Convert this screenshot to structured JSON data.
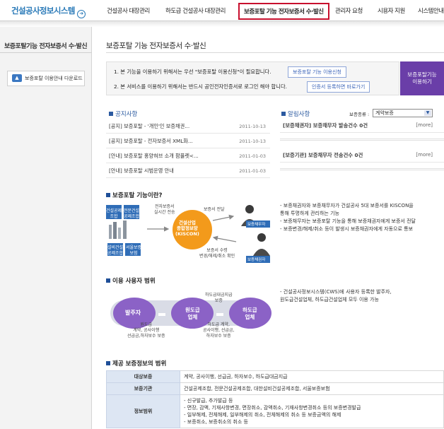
{
  "header": {
    "logo": "건설공사정보시스템",
    "nav": [
      "건설공사 대장관리",
      "하도급 건설공사 대장관리",
      "보증포탈 기능 전자보증서 수·발신",
      "관리자 요청",
      "시용자 지원",
      "시스템안내"
    ]
  },
  "sidebar": {
    "title": "보증포탈기능 전자보증서 수·발신",
    "download_label": "보증포탈 이용안내 다운로드"
  },
  "page_title": "보증포탈 기능 전자보증서 수·발신",
  "notice": {
    "line1": "1. 본 기능을 이용하기 위해서는 우선 \"보증포탈 이용신청\"이 필요합니다.",
    "btn1": "보증포탈 기능 이용신청",
    "line2": "2. 본 서비스를 이용하기 위해서는 반드시 공인전자인증서로 로그인 해야 합니다.",
    "btn2": "인증서 등록하면 바로가기",
    "use_btn": [
      "보증포탈기능",
      "이용하기"
    ]
  },
  "gongji": {
    "title": "공지사항",
    "items": [
      {
        "title": "[공지] 보증포탈 - '개인'인 보증채권...",
        "date": "2011-10-13"
      },
      {
        "title": "[공지] 보증포탈 - 전자보증서 XML화...",
        "date": "2011-10-13"
      },
      {
        "title": "[안내] 보증포탈 홍양혀브 소개 팜플렛<...",
        "date": "2011-01-03"
      },
      {
        "title": "[안내] 보증포탈 시범운영 안내",
        "date": "2011-01-03"
      }
    ]
  },
  "alerts": {
    "title": "알림사항",
    "type_label": "보증종류 :",
    "type_value": "계약보증",
    "items": [
      {
        "title": "[보증채권자] 보증채무자 발송건수 0건",
        "more": "[more]"
      },
      {
        "title": "[보증기관] 보증채무자 전송건수 0건",
        "more": "[more]"
      }
    ]
  },
  "section1": {
    "title": "보증포탈 기능이란?",
    "diagram": {
      "boxes": [
        "전설공제\n조합",
        "전문건설\n공제조합",
        "설비건설\n공제조합",
        "서울보증\n보험"
      ],
      "top_label": "전자보증서\n실시간 전송",
      "center": [
        "건설산업",
        "종합정보망",
        "(KISCON)"
      ],
      "right_top": "보증서 전달",
      "badge_top": "보증채무자",
      "right_bottom": "보증서 수령\n변경/해제/취소 확인",
      "badge_bottom": "보증채권자"
    },
    "desc": [
      "- 보증채권자와 보증채무자가 건설공사 5대 보증서를 KISCON을",
      "  통해 투명하게 관리하는 기능",
      "- 보증채무자는 보증포탈 기능을 통해 보증채권자에게 보증서 전달",
      "- 보증변경/해제/취소 등이 발생시 보증채권자에게 자동으로 통보"
    ]
  },
  "section2": {
    "title": "이용 사용자 범위",
    "diagram": {
      "left": "발주자",
      "mid": [
        "원도급",
        "업체"
      ],
      "right": [
        "하도급",
        "업체"
      ],
      "top_label": "하도급대금지급\n보증",
      "bottom_left_label": "원도급\n계약, 공사이행\n선급금,하자보수 보증",
      "bottom_right_label": "하도급 계약,\n공사이행, 선급금,\n하자보수 보증"
    },
    "desc": [
      "- 건설공사정보시스템(CWS)에 사용자 등록한 발주자,",
      "  원도급건설업체, 하도급건설업체 모두 이용 가능"
    ]
  },
  "section3": {
    "title": "제공 보증정보의 범위",
    "rows": [
      {
        "label": "대상보증",
        "lines": [
          "계약, 공사이행, 선급금, 하자보수, 하도급대금지급"
        ]
      },
      {
        "label": "보증기관",
        "lines": [
          "건설공제조합, 전문건설공제조합, 대한설비건설공제조합, 서울보증보험"
        ]
      },
      {
        "label": "정보범위",
        "lines": [
          "- 신규발급, 추가발급 등",
          "- 면장, 감액, 기재사항변경, 면장취소, 감액취소, 기재사항변경취소 등의 보증변경발급",
          "- 일부해제, 전체해제, 일부해제의 취소, 전체해제의 취소 등 보증금액의 해제",
          "- 보증취소, 보증취소의 취소 등"
        ]
      }
    ]
  },
  "colors": {
    "brand_blue": "#2a7ab8",
    "active_border": "#c8102e",
    "purple": "#6a3ea8",
    "orange": "#f39a1b"
  }
}
